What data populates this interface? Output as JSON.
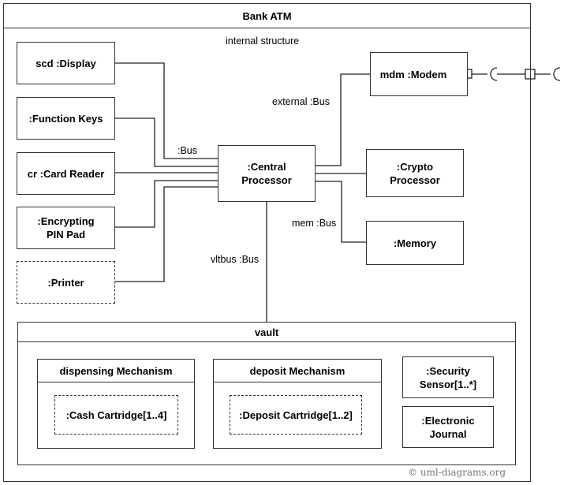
{
  "diagram": {
    "title": "Bank ATM",
    "compartment_label": "internal structure",
    "parts": {
      "display": "scd :Display",
      "function_keys": ":Function Keys",
      "card_reader": "cr :Card Reader",
      "pin_pad_line1": ":Encrypting",
      "pin_pad_line2": "PIN Pad",
      "printer": ":Printer",
      "central_line1": ":Central",
      "central_line2": "Processor",
      "modem": "mdm :Modem",
      "crypto_line1": ":Crypto",
      "crypto_line2": "Processor",
      "memory": ":Memory"
    },
    "connectors": {
      "bus": ":Bus",
      "external_bus": "external :Bus",
      "mem_bus": "mem :Bus",
      "vlt_bus": "vltbus :Bus"
    },
    "vault": {
      "title": "vault",
      "dispensing": {
        "title": "dispensing Mechanism",
        "part": ":Cash Cartridge[1..4]"
      },
      "deposit": {
        "title": "deposit Mechanism",
        "part": ":Deposit Cartridge[1..2]"
      },
      "security_line1": ":Security",
      "security_line2": "Sensor[1..*]",
      "journal_line1": ":Electronic",
      "journal_line2": "Journal"
    },
    "copyright": "© uml-diagrams.org"
  }
}
